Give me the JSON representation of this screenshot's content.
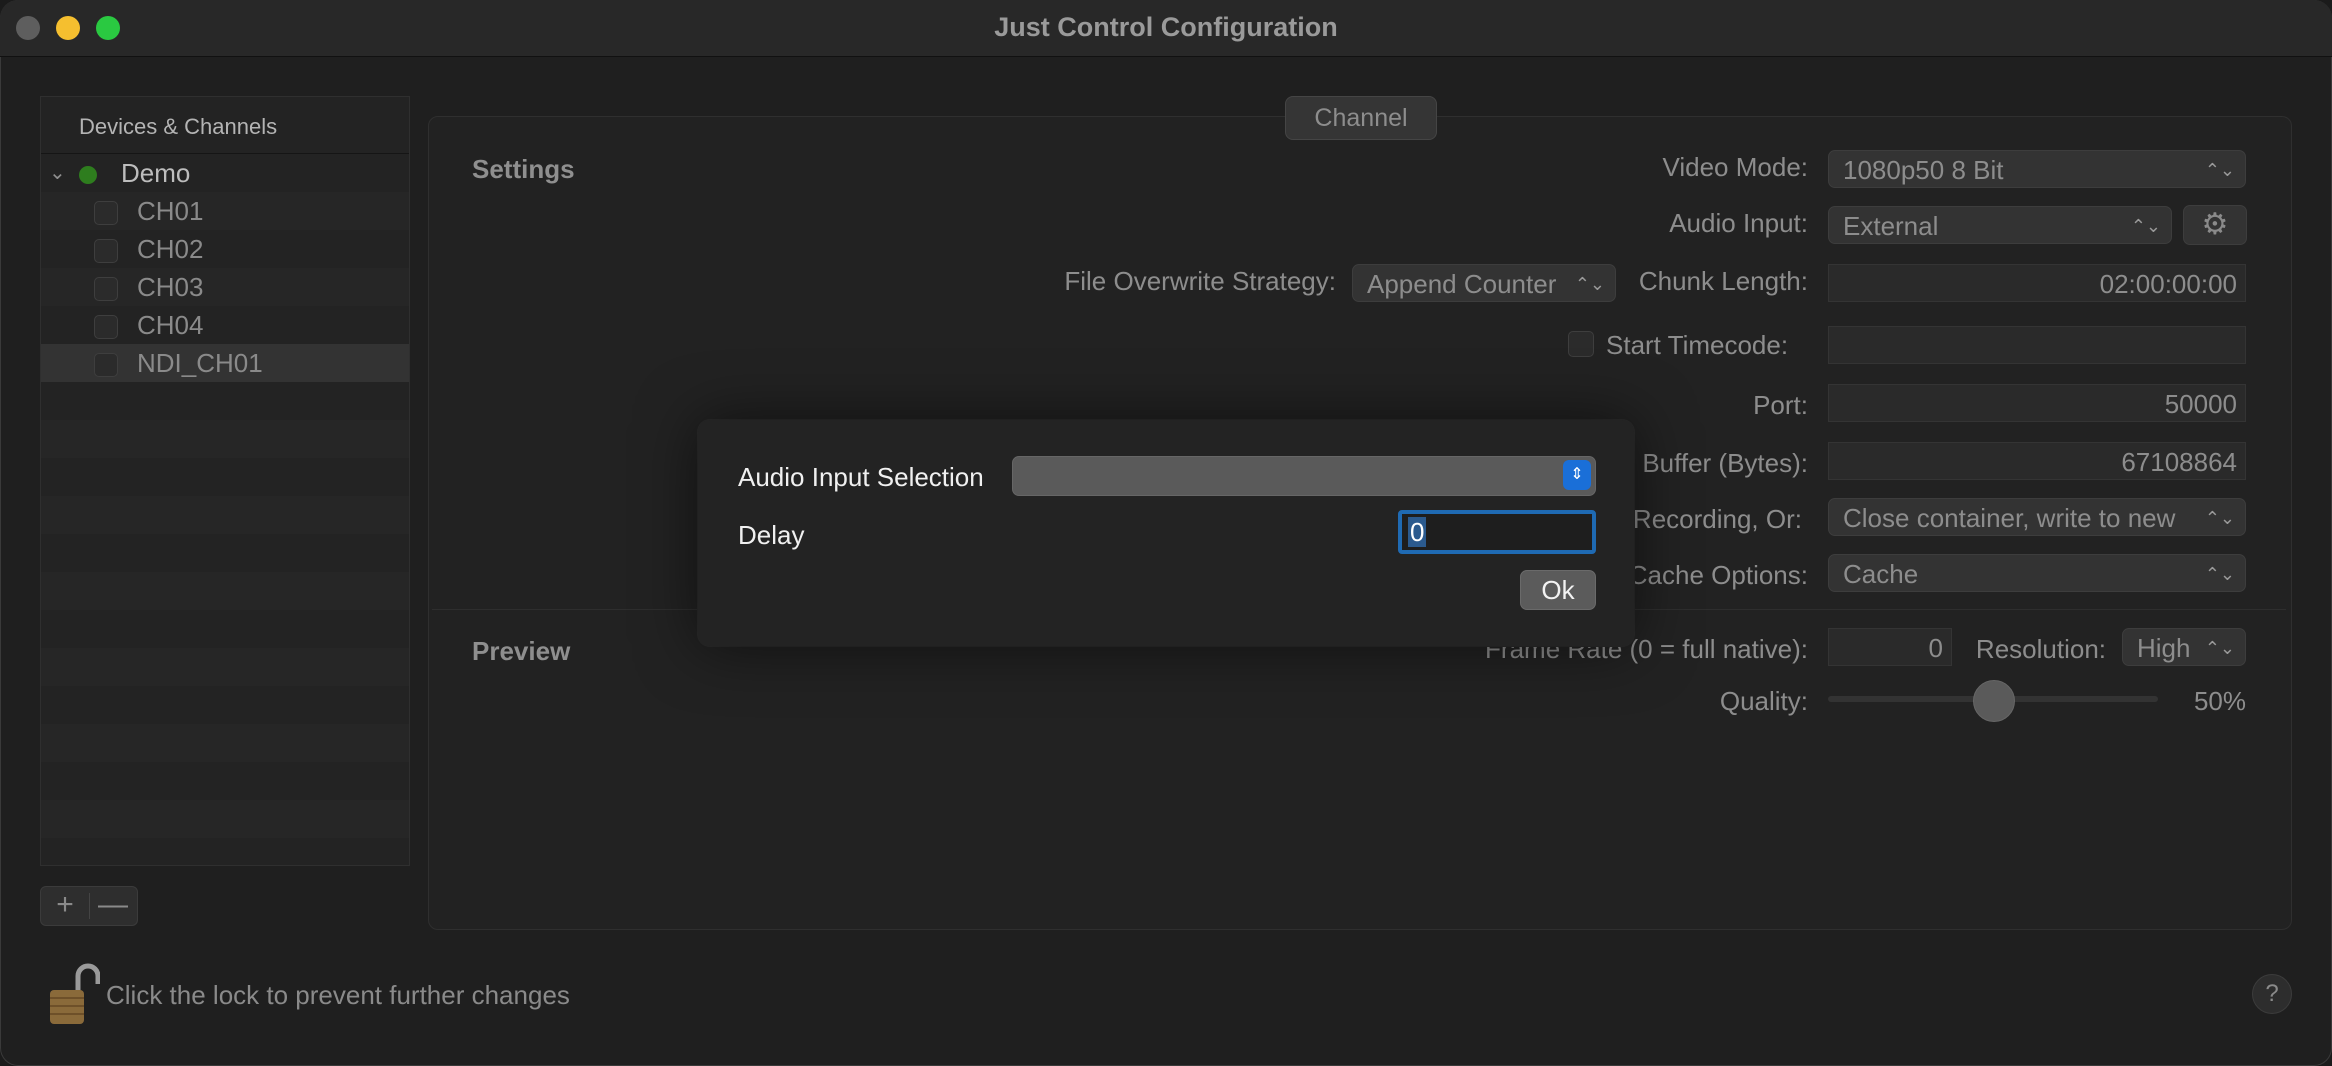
{
  "window": {
    "title": "Just Control Configuration"
  },
  "traffic_lights": {
    "close": "#5e5e5e",
    "minimize": "#f5bf2f",
    "zoom": "#2ac941"
  },
  "sidebar": {
    "header": "Devices & Channels",
    "device": {
      "name": "Demo",
      "status_color": "#2e7d1e"
    },
    "channels": [
      "CH01",
      "CH02",
      "CH03",
      "CH04",
      "NDI_CH01"
    ],
    "add_label": "+",
    "remove_label": "—"
  },
  "main": {
    "tab_label": "Channel",
    "settings": {
      "title": "Settings",
      "video_mode_label": "Video Mode:",
      "video_mode_value": "1080p50 8 Bit",
      "audio_input_label": "Audio Input:",
      "audio_input_value": "External",
      "file_overwrite_label": "File Overwrite Strategy:",
      "file_overwrite_value": "Append Counter",
      "chunk_length_label": "Chunk Length:",
      "chunk_length_value": "02:00:00:00",
      "start_timecode_label": "Start Timecode:",
      "start_timecode_value": "",
      "port_label": "Port:",
      "port_value": "50000",
      "buffer_label": "Buffer (Bytes):",
      "buffer_value": "67108864",
      "recording_label": "Recording, Or:",
      "recording_value": "Close container, write to new",
      "cache_label": "Cache Options:",
      "cache_value": "Cache"
    },
    "preview": {
      "title": "Preview",
      "frame_rate_label": "Frame Rate (0 = full native):",
      "frame_rate_value": "0",
      "resolution_label": "Resolution:",
      "resolution_value": "High",
      "quality_label": "Quality:",
      "quality_value": "50%",
      "quality_fraction": 0.5
    }
  },
  "footer": {
    "lock_text": "Click the lock to prevent further changes",
    "help_label": "?"
  },
  "dialog": {
    "audio_input_selection_label": "Audio Input Selection",
    "audio_input_selection_value": "",
    "delay_label": "Delay",
    "delay_value": "0",
    "ok_label": "Ok"
  }
}
